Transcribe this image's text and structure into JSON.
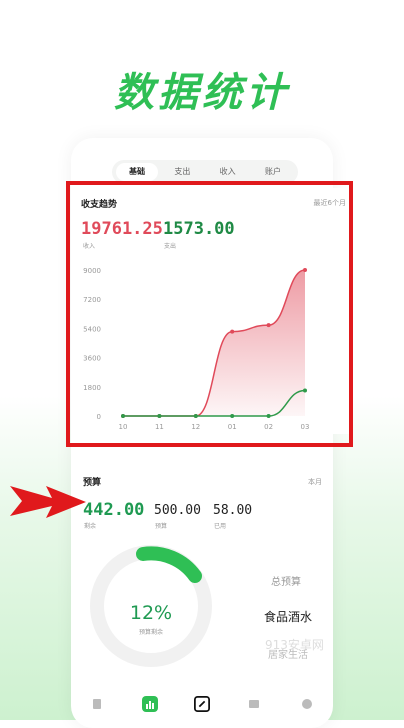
{
  "hero": {
    "title": "数据统计"
  },
  "tabs": [
    "基础",
    "支出",
    "收入",
    "账户"
  ],
  "trend": {
    "title": "收支趋势",
    "range": "最近6个月",
    "income_value": "19761.25",
    "income_label": "收入",
    "expense_value": "1573.00",
    "expense_label": "支出"
  },
  "chart_data": {
    "type": "area",
    "categories": [
      "10",
      "11",
      "12",
      "01",
      "02",
      "03"
    ],
    "series": [
      {
        "name": "收入",
        "values": [
          0,
          0,
          0,
          5200,
          5600,
          9000
        ],
        "color": "#e04a5a"
      },
      {
        "name": "支出",
        "values": [
          0,
          0,
          0,
          0,
          0,
          1573
        ],
        "color": "#2f9a4a"
      }
    ],
    "yticks": [
      "0",
      "1800",
      "3600",
      "5400",
      "7200",
      "9000"
    ],
    "ylim": [
      0,
      9000
    ],
    "grid": false
  },
  "budget": {
    "title": "预算",
    "period": "本月",
    "remaining_value": "442.00",
    "remaining_label": "剩余",
    "budget_value": "500.00",
    "budget_label": "预算",
    "used_value": "58.00",
    "used_label": "已用",
    "percent": "12%",
    "percent_label": "预算剩余",
    "total_label": "总预算",
    "category_food": "食品酒水",
    "category_home": "居家生活",
    "watermark": "913安卓网"
  },
  "nav": [
    "book-icon",
    "chart-icon",
    "edit-icon",
    "wallet-icon",
    "user-icon"
  ],
  "colors": {
    "accent": "#2fbf55",
    "income": "#e04a5a",
    "expense": "#1f8a45",
    "highlight": "#e0191c"
  }
}
